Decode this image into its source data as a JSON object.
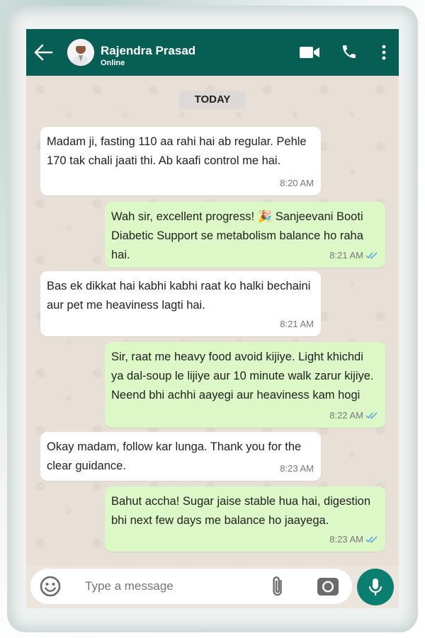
{
  "header": {
    "contact_name": "Rajendra Prasad",
    "status": "Online",
    "back_icon": "arrow-left-icon",
    "video_icon": "video-camera-icon",
    "call_icon": "phone-icon",
    "menu_icon": "more-vertical-icon",
    "color": "#075e54"
  },
  "chat": {
    "date_separator": "TODAY",
    "messages": [
      {
        "direction": "incoming",
        "text": "Madam ji, fasting 110 aa rahi hai ab regular. Pehle 170 tak chali jaati thi. Ab kaafi control me hai.",
        "time": "8:20 AM"
      },
      {
        "direction": "outgoing",
        "text": "Wah sir, excellent progress! 🎉 Sanjeevani Booti Diabetic Support se metabolism balance ho raha hai.",
        "time": "8:21 AM",
        "read": true
      },
      {
        "direction": "incoming",
        "text": "Bas ek dikkat hai kabhi kabhi raat ko halki bechaini aur pet me heaviness lagti hai.",
        "time": "8:21 AM"
      },
      {
        "direction": "outgoing",
        "text": "Sir, raat me heavy food avoid kijiye. Light khichdi ya dal-soup le lijiye aur 10 minute walk zarur kijiye. Neend bhi achhi aayegi aur heaviness kam hogi",
        "time": "8:22 AM",
        "read": true
      },
      {
        "direction": "incoming",
        "text": "Okay madam, follow kar lunga. Thank you for the clear guidance.",
        "time": "8:23 AM"
      },
      {
        "direction": "outgoing",
        "text": "Bahut accha! Sugar jaise stable hua hai, digestion bhi next few days me balance ho jaayega.",
        "time": "8:23 AM",
        "read": true
      }
    ],
    "incoming_color": "#ffffff",
    "outgoing_color": "#dcf8c6",
    "read_tick_color": "#4fa3e0"
  },
  "input": {
    "placeholder": "Type a message",
    "emoji_icon": "emoji-icon",
    "attach_icon": "paperclip-icon",
    "camera_icon": "camera-icon",
    "mic_icon": "microphone-icon"
  }
}
